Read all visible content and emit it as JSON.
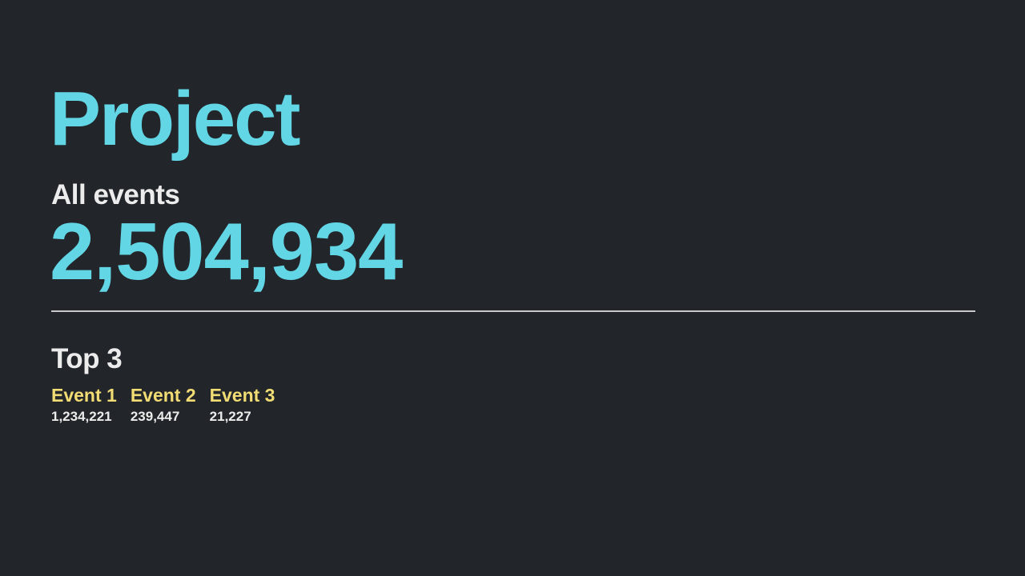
{
  "project": {
    "title": "Project"
  },
  "summary": {
    "label": "All events",
    "total": "2,504,934"
  },
  "top": {
    "heading": "Top 3",
    "events": [
      {
        "name": "Event 1",
        "count": "1,234,221"
      },
      {
        "name": "Event 2",
        "count": "239,447"
      },
      {
        "name": "Event 3",
        "count": "21,227"
      }
    ]
  },
  "colors": {
    "background": "#222529",
    "accent": "#62d6e5",
    "highlight": "#f2dc74",
    "text": "#ececec"
  }
}
